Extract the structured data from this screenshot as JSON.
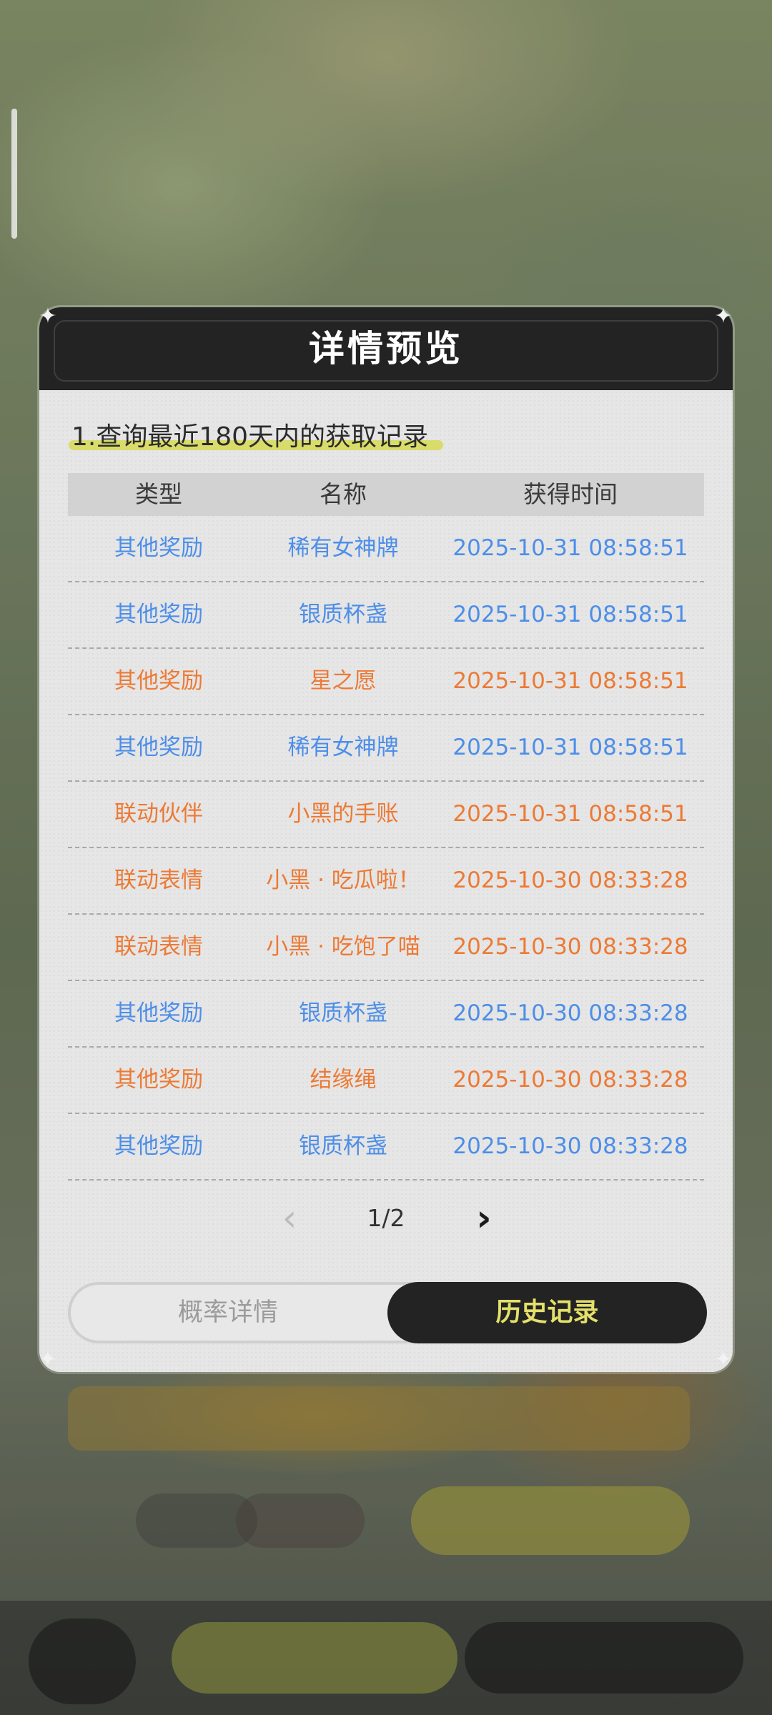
{
  "modal": {
    "title": "详情预览",
    "query_title": "1.查询最近180天内的获取记录"
  },
  "table": {
    "headers": [
      "类型",
      "名称",
      "获得时间"
    ],
    "rows": [
      {
        "type": "其他奖励",
        "name": "稀有女神牌",
        "time": "2025-10-31 08:58:51",
        "color": "#4d8ee8"
      },
      {
        "type": "其他奖励",
        "name": "银质杯盏",
        "time": "2025-10-31 08:58:51",
        "color": "#4d8ee8"
      },
      {
        "type": "其他奖励",
        "name": "星之愿",
        "time": "2025-10-31 08:58:51",
        "color": "#ec7a35"
      },
      {
        "type": "其他奖励",
        "name": "稀有女神牌",
        "time": "2025-10-31 08:58:51",
        "color": "#4d8ee8"
      },
      {
        "type": "联动伙伴",
        "name": "小黑的手账",
        "time": "2025-10-31 08:58:51",
        "color": "#ec7a35"
      },
      {
        "type": "联动表情",
        "name": "小黑 · 吃瓜啦！",
        "time": "2025-10-30 08:33:28",
        "color": "#ec7a35"
      },
      {
        "type": "联动表情",
        "name": "小黑 · 吃饱了喵",
        "time": "2025-10-30 08:33:28",
        "color": "#ec7a35"
      },
      {
        "type": "其他奖励",
        "name": "银质杯盏",
        "time": "2025-10-30 08:33:28",
        "color": "#4d8ee8"
      },
      {
        "type": "其他奖励",
        "name": "结缘绳",
        "time": "2025-10-30 08:33:28",
        "color": "#ec7a35"
      },
      {
        "type": "其他奖励",
        "name": "银质杯盏",
        "time": "2025-10-30 08:33:28",
        "color": "#4d8ee8"
      }
    ]
  },
  "pager": {
    "text": "1/2",
    "prev_icon": "chevron-left-icon",
    "next_icon": "chevron-right-icon"
  },
  "tabs": {
    "left_label": "概率详情",
    "right_label": "历史记录",
    "active": "历史记录"
  },
  "colors": {
    "blue_text": "#4d8ee8",
    "orange_text": "#ec7a35",
    "header_bg": "#232323",
    "accent_yellow": "#e4e06a"
  }
}
